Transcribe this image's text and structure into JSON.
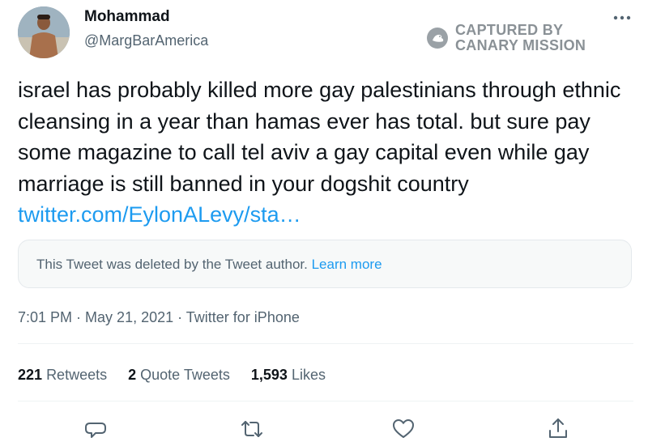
{
  "author": {
    "display_name": "Mohammad",
    "handle": "@MargBarAmerica"
  },
  "watermark": {
    "line1": "CAPTURED BY",
    "line2": "CANARY MISSION"
  },
  "tweet": {
    "text": "israel has probably killed more gay palestinians through ethnic cleansing in a year than hamas ever has total. but sure pay some magazine to call tel aviv a gay capital even while gay marriage is still banned in your dogshit country ",
    "link": "twitter.com/EylonALevy/sta…",
    "quoted_notice": "This Tweet was deleted by the Tweet author.",
    "learn_more": "Learn more",
    "time": "7:01 PM",
    "date": "May 21, 2021",
    "source": "Twitter for iPhone",
    "separator": " · "
  },
  "stats": {
    "retweets_count": "221",
    "retweets_label": "Retweets",
    "quotes_count": "2",
    "quotes_label": "Quote Tweets",
    "likes_count": "1,593",
    "likes_label": "Likes"
  },
  "icons": {
    "more": "more-dots-icon",
    "reply": "reply-icon",
    "retweet": "retweet-icon",
    "like": "like-icon",
    "share": "share-icon"
  },
  "colors": {
    "link": "#1d9bf0",
    "text": "#0f1419",
    "muted": "#536471",
    "watermark": "#8a9196"
  }
}
